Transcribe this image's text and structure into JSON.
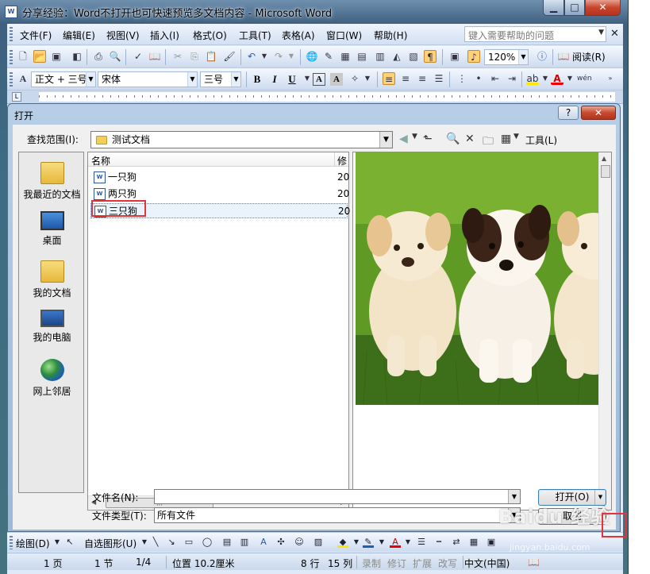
{
  "window": {
    "title": "分享经验：Word不打开也可快速预览多文档内容 - Microsoft Word",
    "app_icon": "W"
  },
  "menubar": {
    "items": [
      "文件(F)",
      "编辑(E)",
      "视图(V)",
      "插入(I)",
      "格式(O)",
      "工具(T)",
      "表格(A)",
      "窗口(W)",
      "帮助(H)"
    ],
    "help_placeholder": "键入需要帮助的问题"
  },
  "toolbar_standard": {
    "zoom": "120%",
    "read_label": "阅读(R)"
  },
  "toolbar_format": {
    "style": "正文 + 三号",
    "font": "宋体",
    "size": "三号"
  },
  "dialog": {
    "title": "打开",
    "help_button": "?",
    "lookin_label": "查找范围(I):",
    "lookin_value": "测试文档",
    "tools_label": "工具(L)",
    "places": [
      "我最近的文档",
      "桌面",
      "我的文档",
      "我的电脑",
      "网上邻居"
    ],
    "columns": [
      "名称",
      "修"
    ],
    "files": [
      {
        "name": "一只狗",
        "date": "20"
      },
      {
        "name": "两只狗",
        "date": "20"
      },
      {
        "name": "三只狗",
        "date": "20"
      }
    ],
    "selected_index": 2,
    "file_name_label": "文件名(N):",
    "file_name_value": "",
    "file_type_label": "文件类型(T):",
    "file_type_value": "所有文件",
    "open_button": "打开(O)",
    "cancel_button": "取消"
  },
  "drawbar": {
    "draw_label": "绘图(D)",
    "autoshapes_label": "自选图形(U)"
  },
  "statusbar": {
    "page": "1 页",
    "section": "1 节",
    "page_of": "1/4",
    "position": "位置 10.2厘米",
    "line": "8 行",
    "column": "15 列",
    "rec": "录制",
    "trk": "修订",
    "ext": "扩展",
    "ovr": "改写",
    "language": "中文(中国)"
  },
  "watermark": {
    "text": "Baidu 经验",
    "sub": "jingyan.baidu.com"
  },
  "colors": {
    "selection_highlight": "#e3343a",
    "title_bar": "#3f607f",
    "toolbar": "#dfe9f7"
  }
}
